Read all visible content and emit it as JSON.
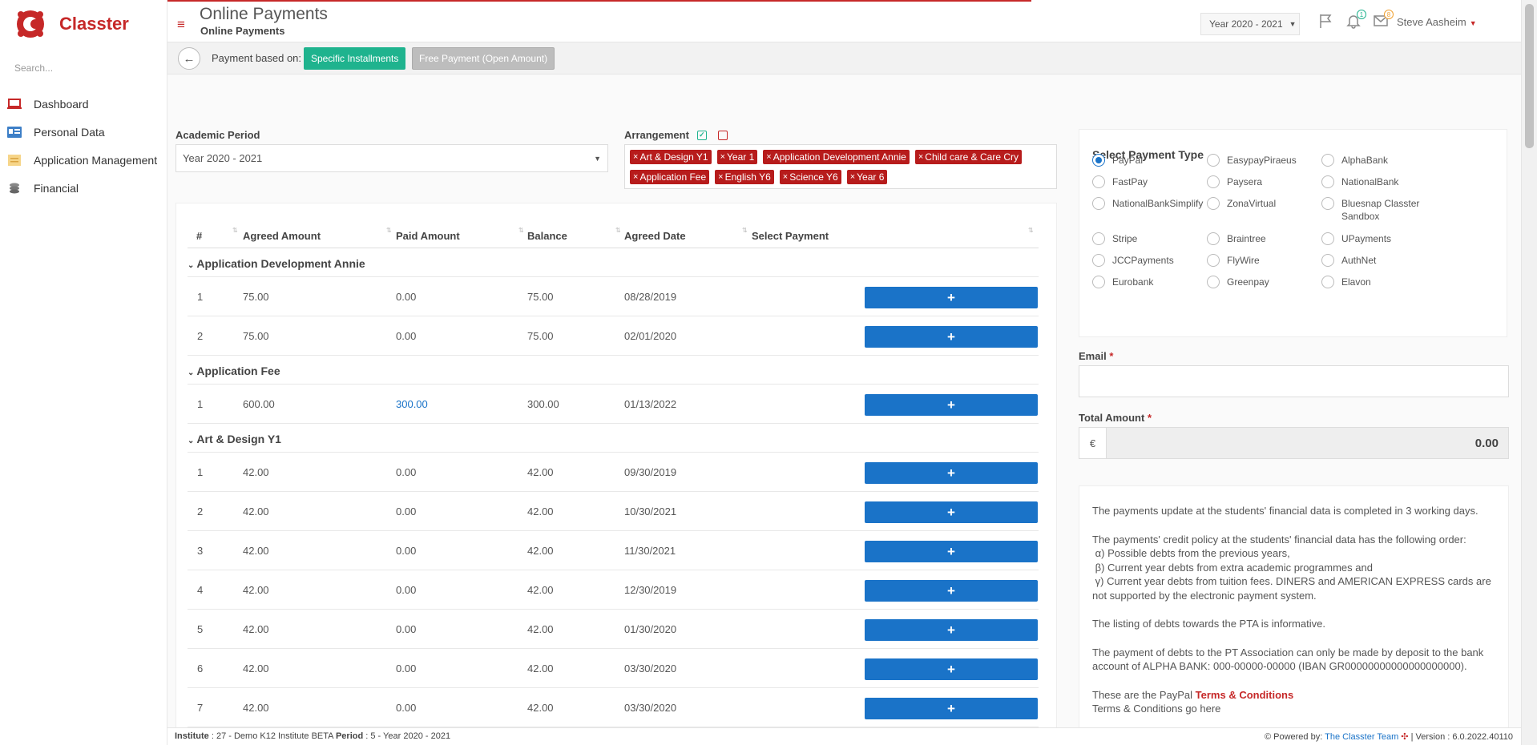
{
  "app": {
    "brand": "Classter"
  },
  "sidebar": {
    "search_placeholder": "Search...",
    "items": [
      {
        "label": "Dashboard",
        "icon": "laptop-icon"
      },
      {
        "label": "Personal Data",
        "icon": "id-card-icon"
      },
      {
        "label": "Application Management",
        "icon": "folder-icon"
      },
      {
        "label": "Financial",
        "icon": "coins-icon"
      }
    ]
  },
  "header": {
    "title": "Online Payments",
    "subtitle": "Online Payments",
    "year_select": "Year 2020 - 2021",
    "notifications_count": "1",
    "messages_count": "8",
    "user_name": "Steve Aasheim"
  },
  "subbar": {
    "label": "Payment based on:",
    "btn_installments": "Specific Installments",
    "btn_free": "Free Payment (Open Amount)"
  },
  "filters": {
    "academic_period_label": "Academic Period",
    "academic_period_value": "Year 2020 - 2021",
    "arrangement_label": "Arrangement",
    "tags": [
      "Art & Design Y1",
      "Year 1",
      "Application Development Annie",
      "Child care & Care Cry",
      "Application Fee",
      "English Y6",
      "Science Y6",
      "Year 6"
    ]
  },
  "table": {
    "headers": [
      "#",
      "Agreed Amount",
      "Paid Amount",
      "Balance",
      "Agreed Date",
      "Select Payment"
    ],
    "groups": [
      {
        "name": "Application Development Annie",
        "rows": [
          [
            "1",
            "75.00",
            "0.00",
            "75.00",
            "08/28/2019"
          ],
          [
            "2",
            "75.00",
            "0.00",
            "75.00",
            "02/01/2020"
          ]
        ]
      },
      {
        "name": "Application Fee",
        "rows": [
          [
            "1",
            "600.00",
            "300.00",
            "300.00",
            "01/13/2022"
          ]
        ]
      },
      {
        "name": "Art & Design Y1",
        "rows": [
          [
            "1",
            "42.00",
            "0.00",
            "42.00",
            "09/30/2019"
          ],
          [
            "2",
            "42.00",
            "0.00",
            "42.00",
            "10/30/2021"
          ],
          [
            "3",
            "42.00",
            "0.00",
            "42.00",
            "11/30/2021"
          ],
          [
            "4",
            "42.00",
            "0.00",
            "42.00",
            "12/30/2019"
          ],
          [
            "5",
            "42.00",
            "0.00",
            "42.00",
            "01/30/2020"
          ],
          [
            "6",
            "42.00",
            "0.00",
            "42.00",
            "03/30/2020"
          ],
          [
            "7",
            "42.00",
            "0.00",
            "42.00",
            "03/30/2020"
          ]
        ]
      }
    ],
    "plus_label": "+"
  },
  "payment_type": {
    "title": "Select Payment Type",
    "selected": "PayPal",
    "options": [
      "PayPal",
      "EasypayPiraeus",
      "AlphaBank",
      "FastPay",
      "Paysera",
      "NationalBank",
      "NationalBankSimplify",
      "ZonaVirtual",
      "Bluesnap Classter Sandbox",
      "Stripe",
      "Braintree",
      "UPayments",
      "JCCPayments",
      "FlyWire",
      "AuthNet",
      "Eurobank",
      "Greenpay",
      "Elavon"
    ]
  },
  "form": {
    "email_label": "Email",
    "total_label": "Total Amount",
    "required_mark": "*",
    "currency": "€",
    "total_value": "0.00"
  },
  "info": {
    "p1": "The payments update at the students' financial data is completed in 3 working days.",
    "p2_intro": "The payments' credit policy at the students' financial data has the following order:",
    "p2_a": "α) Possible debts from the previous years,",
    "p2_b": "β) Current year debts from extra academic programmes and",
    "p2_c": "γ) Current year debts from tuition fees. DINERS and AMERICAN EXPRESS cards are not supported by the electronic payment system.",
    "p3": "The listing of debts towards the PTA is informative.",
    "p4": "The payment of debts to the PT Association can only be made by deposit to the bank account of ALPHA BANK: 000-00000-00000 (IBAN GR00000000000000000000).",
    "p5_prefix": "These are the PayPal",
    "p5_link": "Terms & Conditions",
    "p6": "Terms & Conditions go here"
  },
  "footer": {
    "institute_label": "Institute",
    "institute_value": ": 27 - Demo K12 Institute BETA",
    "period_label": "Period",
    "period_value": ": 5 - Year 2020 - 2021",
    "powered_by": "Powered by:",
    "team": "The Classter Team",
    "version": "| Version : 6.0.2022.40110"
  },
  "colors": {
    "brand_red": "#c62828",
    "primary_blue": "#1a73c8",
    "success_green": "#1fb38e"
  }
}
